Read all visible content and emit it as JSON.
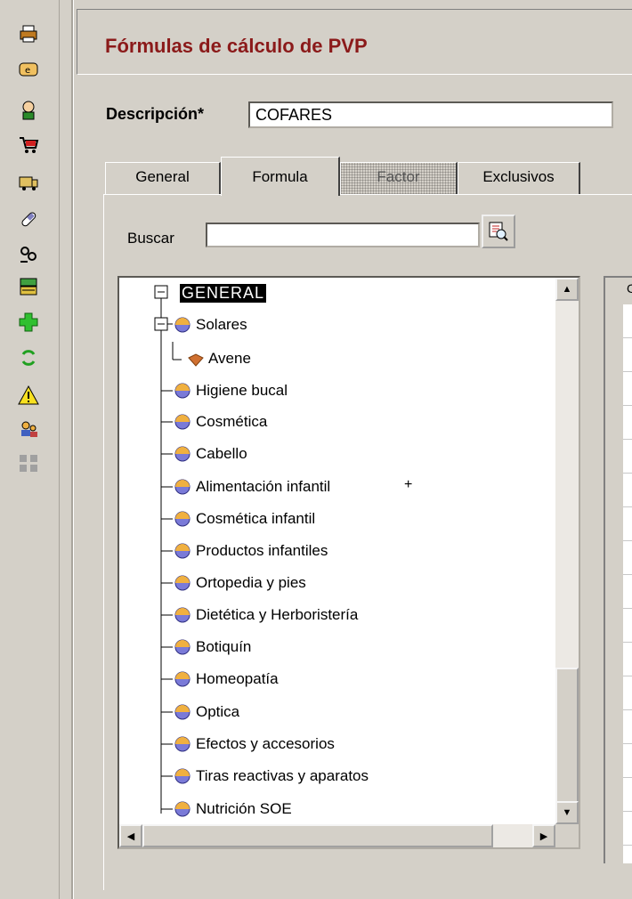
{
  "toolbar": {
    "icons": [
      "printer-icon",
      "ticket-icon",
      "pharmacist-icon",
      "cart-icon",
      "truck-icon",
      "pill-icon",
      "people-icon",
      "register-icon",
      "add-icon",
      "refresh-icon",
      "warning-icon",
      "user-icon",
      "group-icon"
    ]
  },
  "header": {
    "title": "Fórmulas de cálculo de PVP"
  },
  "form": {
    "description_label": "Descripción*",
    "description_value": "COFARES"
  },
  "tabs": [
    {
      "label": "General"
    },
    {
      "label": "Formula"
    },
    {
      "label": "Factor"
    },
    {
      "label": "Exclusivos"
    }
  ],
  "search": {
    "label": "Buscar",
    "value": ""
  },
  "tree": {
    "root": "GENERAL",
    "items": [
      {
        "label": "Solares"
      },
      {
        "label": "Avene"
      },
      {
        "label": "Higiene bucal"
      },
      {
        "label": "Cosmética"
      },
      {
        "label": "Cabello"
      },
      {
        "label": "Alimentación infantil"
      },
      {
        "label": "Cosmética infantil"
      },
      {
        "label": "Productos infantiles"
      },
      {
        "label": "Ortopedia y pies"
      },
      {
        "label": "Dietética y Herboristería"
      },
      {
        "label": "Botiquín"
      },
      {
        "label": "Homeopatía"
      },
      {
        "label": "Optica"
      },
      {
        "label": "Efectos y accesorios"
      },
      {
        "label": "Tiras reactivas y aparatos"
      },
      {
        "label": "Nutrición SOE"
      }
    ],
    "stray_mark": "+"
  },
  "grid": {
    "header_char": "C"
  }
}
